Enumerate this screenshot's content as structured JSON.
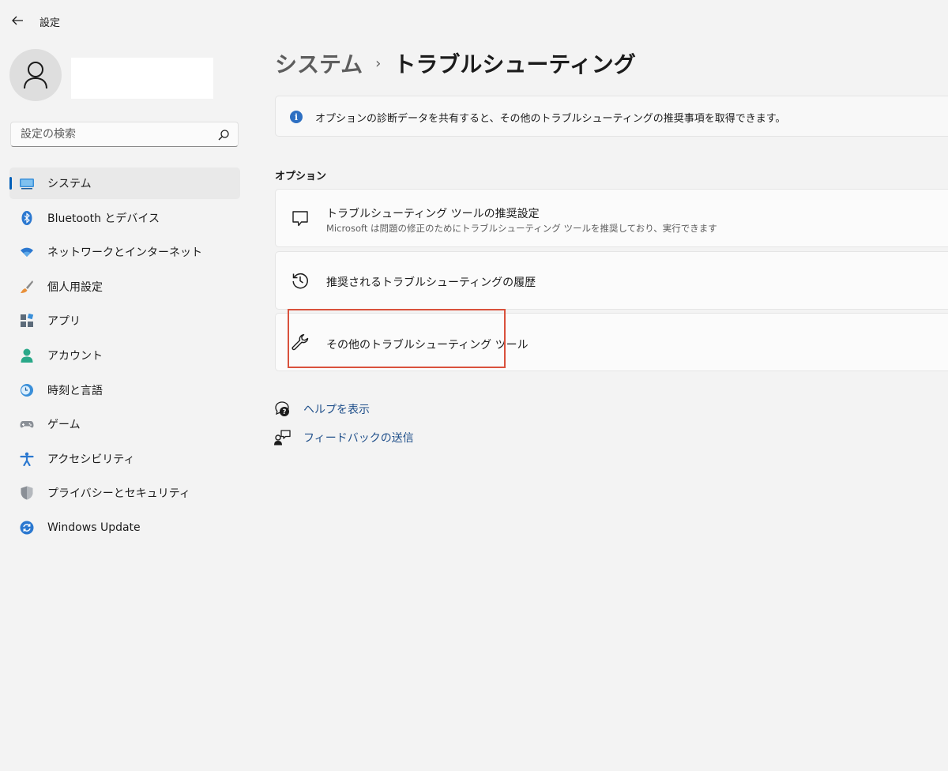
{
  "app": {
    "title": "設定"
  },
  "search": {
    "placeholder": "設定の検索"
  },
  "sidebar": {
    "items": [
      {
        "label": "システム",
        "icon": "display-icon",
        "selected": true
      },
      {
        "label": "Bluetooth とデバイス",
        "icon": "bluetooth-icon"
      },
      {
        "label": "ネットワークとインターネット",
        "icon": "wifi-icon"
      },
      {
        "label": "個人用設定",
        "icon": "brush-icon"
      },
      {
        "label": "アプリ",
        "icon": "apps-icon"
      },
      {
        "label": "アカウント",
        "icon": "account-icon"
      },
      {
        "label": "時刻と言語",
        "icon": "time-language-icon"
      },
      {
        "label": "ゲーム",
        "icon": "gamepad-icon"
      },
      {
        "label": "アクセシビリティ",
        "icon": "accessibility-icon"
      },
      {
        "label": "プライバシーとセキュリティ",
        "icon": "shield-icon"
      },
      {
        "label": "Windows Update",
        "icon": "update-icon"
      }
    ]
  },
  "breadcrumb": {
    "parent": "システム",
    "separator": "›",
    "current": "トラブルシューティング"
  },
  "info": {
    "text": "オプションの診断データを共有すると、その他のトラブルシューティングの推奨事項を取得できます。"
  },
  "options": {
    "title": "オプション",
    "items": [
      {
        "title": "トラブルシューティング ツールの推奨設定",
        "subtitle": "Microsoft は問題の修正のためにトラブルシューティング ツールを推奨しており、実行できます",
        "icon": "chat-bubble-icon"
      },
      {
        "title": "推奨されるトラブルシューティングの履歴",
        "icon": "history-icon"
      },
      {
        "title": "その他のトラブルシューティング ツール",
        "icon": "wrench-icon"
      }
    ]
  },
  "links": [
    {
      "label": "ヘルプを表示",
      "icon": "help-icon"
    },
    {
      "label": "フィードバックの送信",
      "icon": "feedback-icon"
    }
  ],
  "colors": {
    "accent": "#005fb8",
    "highlight": "#d9513c",
    "link": "#1f4f8a"
  }
}
